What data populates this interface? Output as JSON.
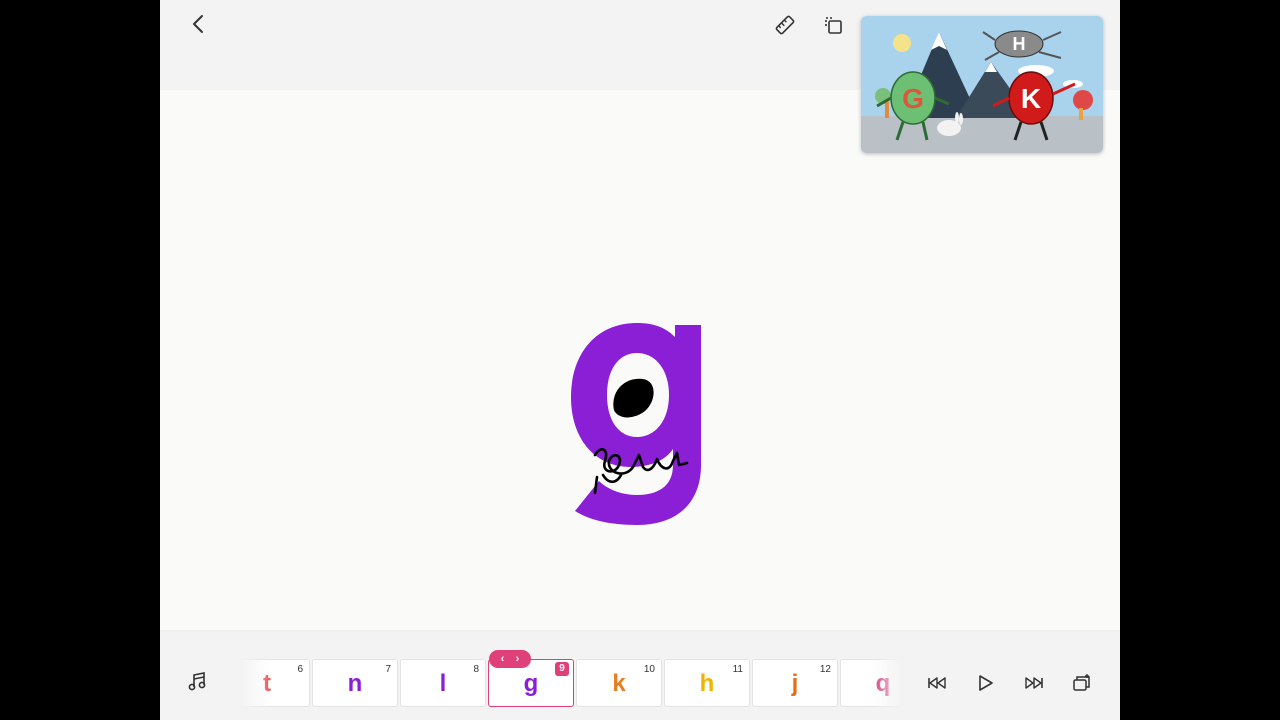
{
  "topbar": {
    "icons": [
      "chevron-left-icon",
      "ruler-icon",
      "copy-layers-icon"
    ]
  },
  "canvas": {
    "letter": "g",
    "letter_color": "#8a1fd6",
    "scribble_color": "#000000"
  },
  "preview": {
    "letters": [
      "G",
      "K",
      "H"
    ],
    "colors": {
      "g_character": "#6cbf73",
      "k_character": "#d11b1b",
      "h_character": "#8a8a8a"
    }
  },
  "strip": {
    "selected_index": 3,
    "accent": "#e0407a",
    "reorder_arrows": {
      "left": "‹",
      "right": "›"
    },
    "cards": [
      {
        "letter": "t",
        "number": "6",
        "color": "#e85a5a"
      },
      {
        "letter": "n",
        "number": "7",
        "color": "#8a1fd6"
      },
      {
        "letter": "l",
        "number": "8",
        "color": "#8a1fd6"
      },
      {
        "letter": "g",
        "number": "9",
        "color": "#8a1fd6"
      },
      {
        "letter": "k",
        "number": "10",
        "color": "#e67e22"
      },
      {
        "letter": "h",
        "number": "11",
        "color": "#f0b400"
      },
      {
        "letter": "j",
        "number": "12",
        "color": "#e0701a"
      },
      {
        "letter": "q",
        "number": "",
        "color": "#d83a7c"
      }
    ]
  },
  "controls": {
    "icons": [
      "music-note-icon",
      "skip-back-icon",
      "play-icon",
      "skip-forward-icon",
      "layers-add-icon"
    ]
  }
}
